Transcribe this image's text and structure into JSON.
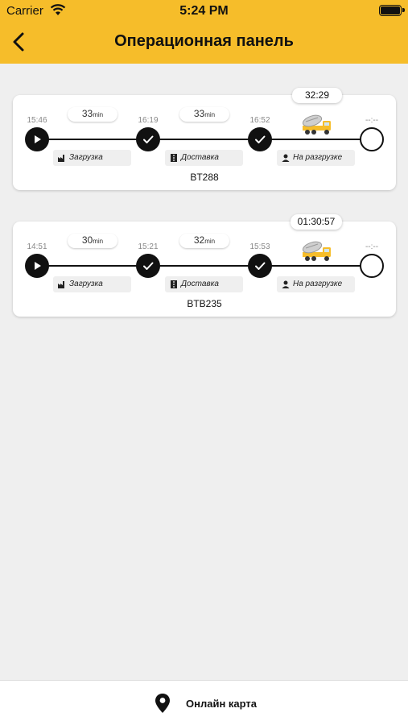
{
  "status_bar": {
    "carrier": "Carrier",
    "time": "5:24 PM"
  },
  "header": {
    "title": "Операционная панель"
  },
  "cards": [
    {
      "timer": "32:29",
      "times": [
        "15:46",
        "16:19",
        "16:52",
        "--:--"
      ],
      "durations": [
        {
          "value": "33",
          "unit": "min"
        },
        {
          "value": "33",
          "unit": "min"
        }
      ],
      "stages": [
        "Загрузка",
        "Доставка",
        "На разгрузке"
      ],
      "plate": "BT288"
    },
    {
      "timer": "01:30:57",
      "times": [
        "14:51",
        "15:21",
        "15:53",
        "--:--"
      ],
      "durations": [
        {
          "value": "30",
          "unit": "min"
        },
        {
          "value": "32",
          "unit": "min"
        }
      ],
      "stages": [
        "Загрузка",
        "Доставка",
        "На разгрузке"
      ],
      "plate": "BTB235"
    }
  ],
  "bottom_bar": {
    "label": "Онлайн карта",
    "icon": "map-pin-icon"
  },
  "colors": {
    "accent": "#f6bd2a",
    "background": "#efefef",
    "node": "#111111"
  }
}
